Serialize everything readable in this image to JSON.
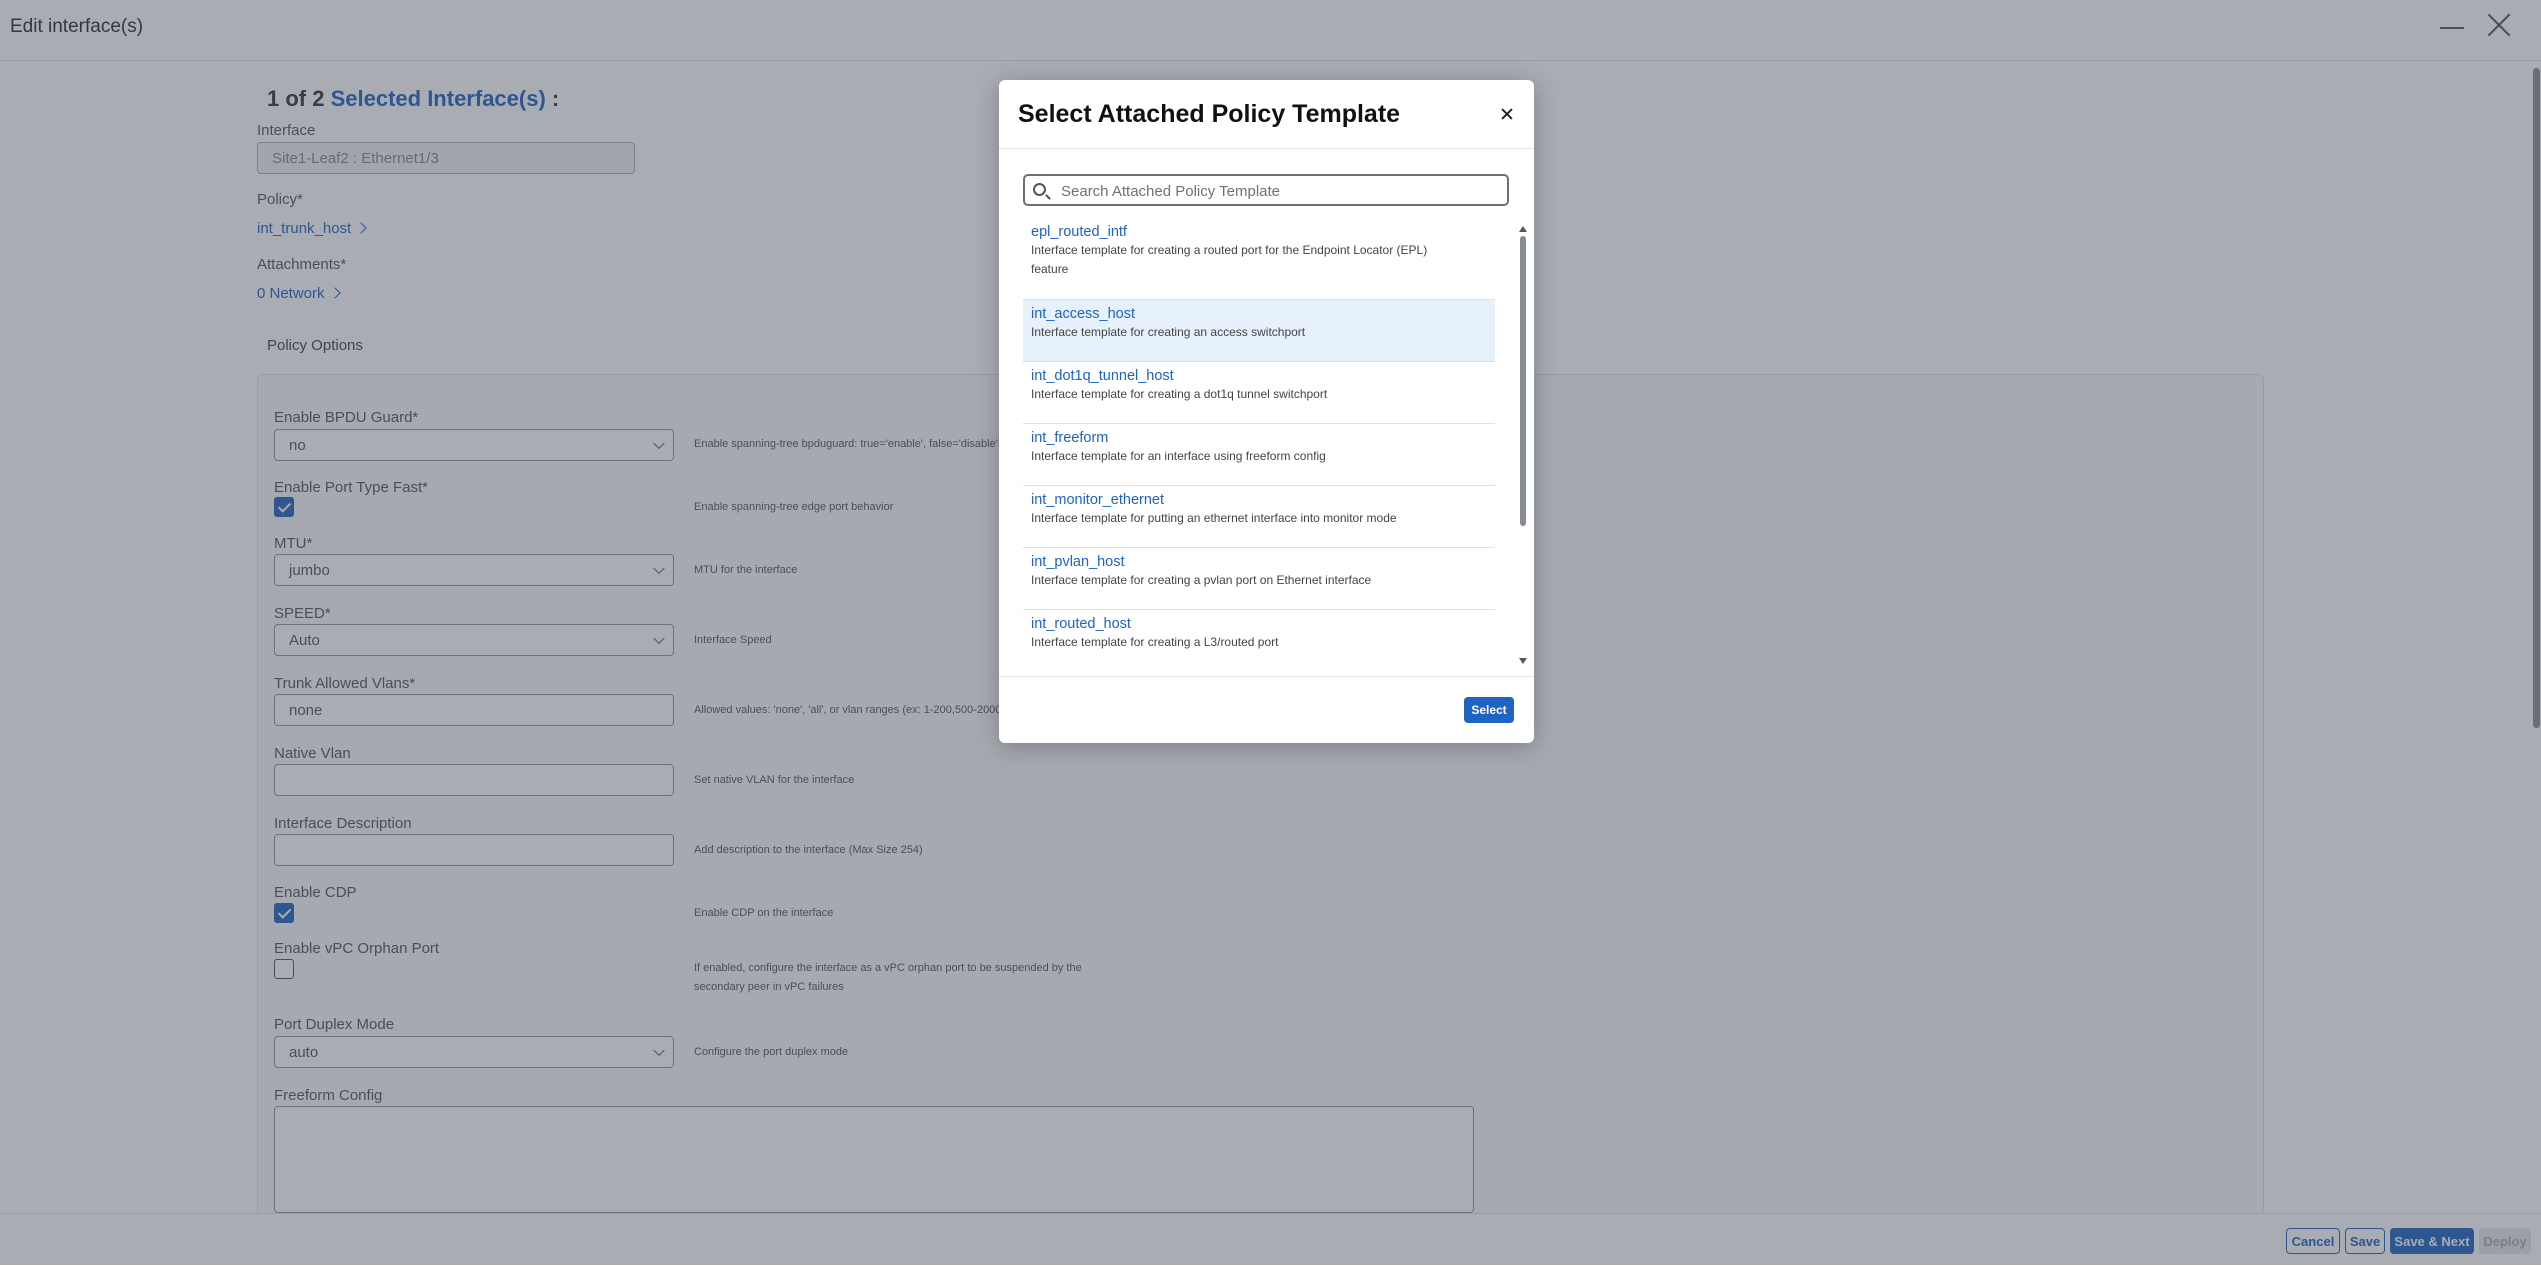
{
  "window": {
    "title": "Edit interface(s)"
  },
  "selection": {
    "count_prefix": "1 of 2",
    "highlight": "Selected Interface(s)",
    "suffix": ":"
  },
  "interface": {
    "label": "Interface",
    "value": "Site1-Leaf2 : Ethernet1/3"
  },
  "policy": {
    "label": "Policy*",
    "value": "int_trunk_host"
  },
  "attachments": {
    "label": "Attachments*",
    "value": "0 Network"
  },
  "policy_options": {
    "title": "Policy Options",
    "bpdu_guard": {
      "label": "Enable BPDU Guard*",
      "value": "no",
      "help": "Enable spanning-tree bpduguard: true='enable', false='disable', no..."
    },
    "port_type_fast": {
      "label": "Enable Port Type Fast*",
      "checked": true,
      "help": "Enable spanning-tree edge port behavior"
    },
    "mtu": {
      "label": "MTU*",
      "value": "jumbo",
      "help": "MTU for the interface"
    },
    "speed": {
      "label": "SPEED*",
      "value": "Auto",
      "help": "Interface Speed"
    },
    "trunk_vlans": {
      "label": "Trunk Allowed Vlans*",
      "value": "none",
      "help": "Allowed values: 'none', 'all', or vlan ranges (ex: 1-200,500-2000,3..."
    },
    "native_vlan": {
      "label": "Native Vlan",
      "value": "",
      "help": "Set native VLAN for the interface"
    },
    "description": {
      "label": "Interface Description",
      "value": "",
      "help": "Add description to the interface (Max Size 254)"
    },
    "cdp": {
      "label": "Enable CDP",
      "checked": true,
      "help": "Enable CDP on the interface"
    },
    "vpc_orphan": {
      "label": "Enable vPC Orphan Port",
      "checked": false,
      "help_line1": "If enabled, configure the interface as a vPC orphan port to be suspended by the",
      "help_line2": "secondary peer in vPC failures"
    },
    "duplex": {
      "label": "Port Duplex Mode",
      "value": "auto",
      "help": "Configure the port duplex mode"
    },
    "freeform": {
      "label": "Freeform Config",
      "value": ""
    }
  },
  "footer": {
    "cancel": "Cancel",
    "save": "Save",
    "save_next": "Save & Next",
    "deploy": "Deploy"
  },
  "modal": {
    "title": "Select Attached Policy Template",
    "search_placeholder": "Search Attached Policy Template",
    "select_label": "Select",
    "items": [
      {
        "name": "epl_routed_intf",
        "desc_line1": "Interface template for creating a routed port for the Endpoint Locator (EPL)",
        "desc_line2": "feature",
        "selected": false
      },
      {
        "name": "int_access_host",
        "desc_line1": "Interface template for creating an access switchport",
        "selected": true
      },
      {
        "name": "int_dot1q_tunnel_host",
        "desc_line1": "Interface template for creating a dot1q tunnel switchport",
        "selected": false
      },
      {
        "name": "int_freeform",
        "desc_line1": "Interface template for an interface using freeform config",
        "selected": false
      },
      {
        "name": "int_monitor_ethernet",
        "desc_line1": "Interface template for putting an ethernet interface into monitor mode",
        "selected": false
      },
      {
        "name": "int_pvlan_host",
        "desc_line1": "Interface template for creating a pvlan port on Ethernet interface",
        "selected": false
      },
      {
        "name": "int_routed_host",
        "desc_line1": "Interface template for creating a L3/routed port",
        "selected": false
      }
    ]
  },
  "colors": {
    "accent": "#1f63c3",
    "selected_row": "#e6f1fc",
    "overlay": "#404854"
  }
}
